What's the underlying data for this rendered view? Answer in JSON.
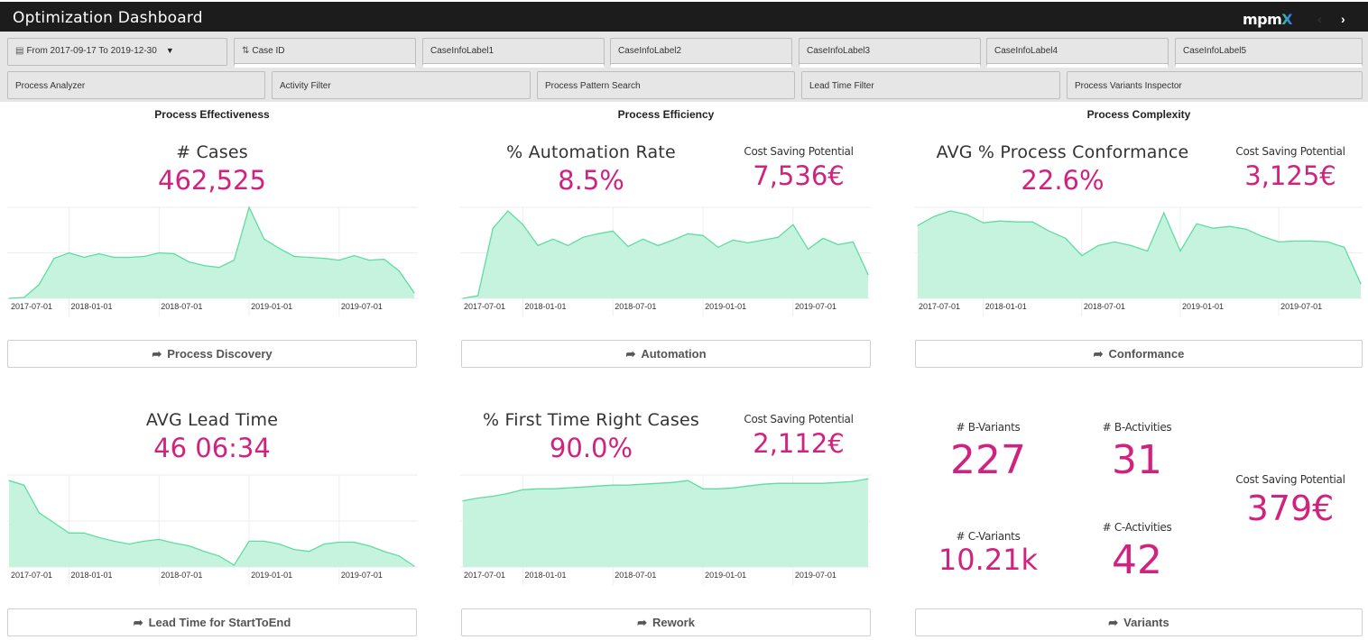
{
  "app": {
    "title": "Optimization Dashboard",
    "logo_text": "mpm",
    "logo_accent": "X",
    "nav_prev_icon": "‹",
    "nav_next_icon": "›"
  },
  "filters": {
    "date_range": "From 2017-09-17 To 2019-12-30",
    "date_icon": "calendar-icon",
    "case_id": "Case ID",
    "case_id_icon": "field-icon",
    "case_info_labels": [
      "CaseInfoLabel1",
      "CaseInfoLabel2",
      "CaseInfoLabel3",
      "CaseInfoLabel4",
      "CaseInfoLabel5"
    ],
    "apps": [
      "Process Analyzer",
      "Activity Filter",
      "Process Pattern Search",
      "Lead Time Filter",
      "Process Variants Inspector"
    ]
  },
  "sections": {
    "effectiveness": "Process Effectiveness",
    "efficiency": "Process Efficiency",
    "complexity": "Process Complexity"
  },
  "kpis": {
    "cases": {
      "label": "# Cases",
      "value": "462,525"
    },
    "automation": {
      "label": "% Automation Rate",
      "value": "8.5%",
      "csp_label": "Cost Saving Potential",
      "csp_value": "7,536€"
    },
    "conformance": {
      "label": "AVG % Process Conformance",
      "value": "22.6%",
      "csp_label": "Cost Saving Potential",
      "csp_value": "3,125€"
    },
    "lead_time": {
      "label": "AVG Lead Time",
      "value": "46 06:34"
    },
    "ftr": {
      "label": "% First Time Right Cases",
      "value": "90.0%",
      "csp_label": "Cost Saving Potential",
      "csp_value": "2,112€"
    },
    "variants": {
      "b_variants_label": "# B-Variants",
      "b_variants_value": "227",
      "b_activities_label": "# B-Activities",
      "b_activities_value": "31",
      "c_variants_label": "# C-Variants",
      "c_variants_value": "10.21k",
      "c_activities_label": "# C-Activities",
      "c_activities_value": "42",
      "csp_label": "Cost Saving Potential",
      "csp_value": "379€"
    }
  },
  "buttons": {
    "process_discovery": "Process Discovery",
    "automation": "Automation",
    "conformance": "Conformance",
    "lead_time": "Lead Time for StartToEnd",
    "rework": "Rework",
    "variants": "Variants",
    "arrow_icon": "➦"
  },
  "colors": {
    "accent": "#d0237f",
    "area_fill": "#c6f3dd",
    "area_line": "#5fdca4",
    "titlebar": "#1c1c1c",
    "filterbar": "#e6e6e6"
  },
  "chart_data": [
    {
      "id": "cases",
      "type": "area",
      "title": "# Cases",
      "x_start": "2017-09",
      "x_interval": "month",
      "xticks": [
        "2017-07-01",
        "2018-01-01",
        "2018-07-01",
        "2019-01-01",
        "2019-07-01"
      ],
      "ylim": [
        0,
        100
      ],
      "grid": true,
      "values": [
        0,
        1,
        15,
        44,
        50,
        45,
        49,
        45,
        45,
        46,
        50,
        49,
        40,
        36,
        34,
        42,
        100,
        65,
        55,
        46,
        45,
        44,
        42,
        47,
        42,
        43,
        30,
        6
      ]
    },
    {
      "id": "automation",
      "type": "area",
      "title": "% Automation Rate",
      "x_start": "2017-09",
      "x_interval": "month",
      "xticks": [
        "2017-07-01",
        "2018-01-01",
        "2018-07-01",
        "2019-01-01",
        "2019-07-01"
      ],
      "ylim": [
        0,
        100
      ],
      "grid": true,
      "values": [
        0,
        3,
        77,
        96,
        81,
        58,
        65,
        58,
        67,
        71,
        74,
        57,
        65,
        58,
        64,
        71,
        69,
        56,
        64,
        61,
        64,
        67,
        81,
        54,
        66,
        59,
        62,
        26
      ]
    },
    {
      "id": "conformance",
      "type": "area",
      "title": "AVG % Process Conformance",
      "x_start": "2017-09",
      "x_interval": "month",
      "xticks": [
        "2017-07-01",
        "2018-01-01",
        "2018-07-01",
        "2019-01-01",
        "2019-07-01"
      ],
      "ylim": [
        0,
        100
      ],
      "grid": true,
      "values": [
        80,
        90,
        96,
        92,
        83,
        85,
        84,
        84,
        74,
        66,
        47,
        58,
        62,
        58,
        52,
        94,
        52,
        82,
        77,
        79,
        76,
        68,
        62,
        63,
        63,
        62,
        56,
        16
      ]
    },
    {
      "id": "lead_time",
      "type": "area",
      "title": "AVG Lead Time",
      "x_start": "2017-09",
      "x_interval": "month",
      "xticks": [
        "2017-07-01",
        "2018-01-01",
        "2018-07-01",
        "2019-01-01",
        "2019-07-01"
      ],
      "ylim": [
        0,
        100
      ],
      "grid": true,
      "values": [
        94,
        89,
        59,
        48,
        37,
        37,
        32,
        28,
        25,
        28,
        30,
        26,
        23,
        17,
        12,
        2,
        28,
        28,
        25,
        19,
        17,
        25,
        27,
        27,
        23,
        17,
        12,
        1
      ]
    },
    {
      "id": "ftr",
      "type": "area",
      "title": "% First Time Right Cases",
      "x_start": "2017-09",
      "x_interval": "month",
      "xticks": [
        "2017-07-01",
        "2018-01-01",
        "2018-07-01",
        "2019-01-01",
        "2019-07-01"
      ],
      "ylim": [
        0,
        100
      ],
      "grid": true,
      "values": [
        72,
        75,
        77,
        80,
        84,
        85,
        85,
        86,
        87,
        88,
        89,
        89,
        90,
        91,
        92,
        94,
        85,
        85,
        86,
        88,
        90,
        91,
        91,
        91,
        91,
        92,
        93,
        96
      ]
    }
  ]
}
